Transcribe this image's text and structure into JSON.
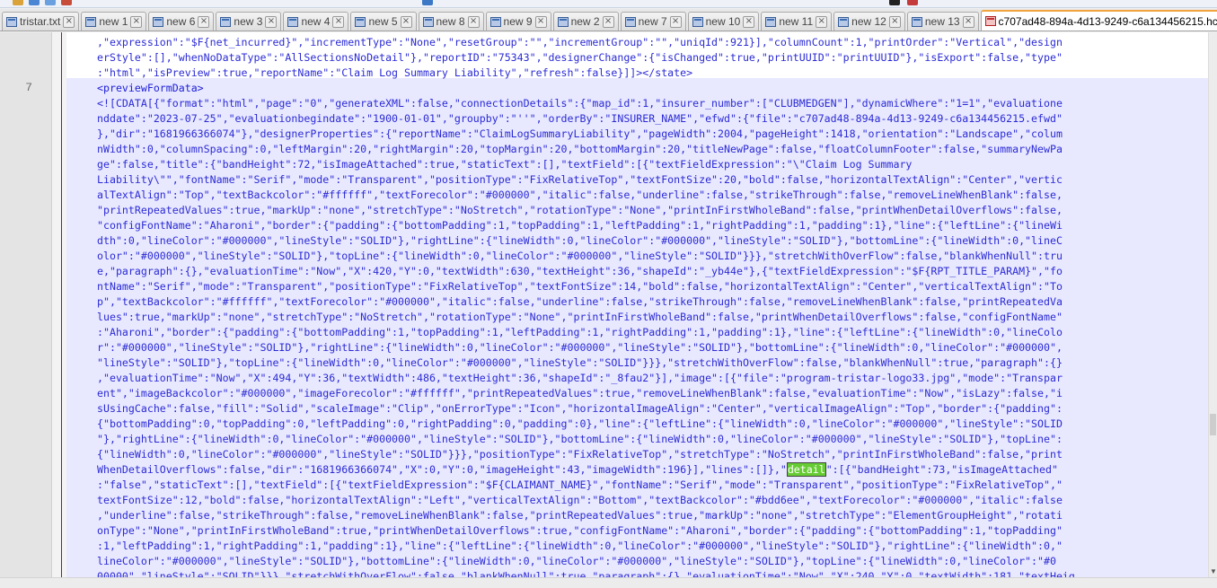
{
  "tabs": [
    {
      "label": "tristar.txt",
      "active": false,
      "icon": "file-icon"
    },
    {
      "label": "new 1",
      "active": false,
      "icon": "file-icon"
    },
    {
      "label": "new 6",
      "active": false,
      "icon": "file-icon"
    },
    {
      "label": "new 3",
      "active": false,
      "icon": "file-icon"
    },
    {
      "label": "new 4",
      "active": false,
      "icon": "file-icon"
    },
    {
      "label": "new 5",
      "active": false,
      "icon": "file-icon"
    },
    {
      "label": "new 8",
      "active": false,
      "icon": "file-icon"
    },
    {
      "label": "new 9",
      "active": false,
      "icon": "file-icon"
    },
    {
      "label": "new 2",
      "active": false,
      "icon": "file-icon"
    },
    {
      "label": "new 7",
      "active": false,
      "icon": "file-icon"
    },
    {
      "label": "new 10",
      "active": false,
      "icon": "file-icon"
    },
    {
      "label": "new 11",
      "active": false,
      "icon": "file-icon"
    },
    {
      "label": "new 12",
      "active": false,
      "icon": "file-icon"
    },
    {
      "label": "new 13",
      "active": false,
      "icon": "file-icon"
    },
    {
      "label": "c707ad48-894a-4d13-9249-c6a134456215.hcr",
      "active": true,
      "icon": "modified-file-icon"
    }
  ],
  "editor": {
    "line_number": "7",
    "prev_lines": [
      ",\"expression\":\"$F{net_incurred}\",\"incrementType\":\"None\",\"resetGroup\":\"\",\"incrementGroup\":\"\",\"uniqId\":921}],\"columnCount\":1,\"printOrder\":\"Vertical\",\"design",
      "erStyle\":[],\"whenNoDataType\":\"AllSectionsNoDetail\"},\"reportID\":\"75343\",\"designerChange\":{\"isChanged\":true,\"printUUID\":\"printUUID\"},\"isExport\":false,\"type\"",
      ":\"html\",\"isPreview\":true,\"reportName\":\"Claim Log Summary Liability\",\"refresh\":false}]]></state>"
    ],
    "tag_line": "<previewFormData>",
    "lines": [
      "<![CDATA[{\"format\":\"html\",\"page\":\"0\",\"generateXML\":false,\"connectionDetails\":{\"map_id\":1,\"insurer_number\":[\"CLUBMEDGEN\"],\"dynamicWhere\":\"1=1\",\"evaluatione",
      "nddate\":\"2023-07-25\",\"evaluationbegindate\":\"1900-01-01\",\"groupby\":\"''\",\"orderBy\":\"INSURER_NAME\",\"efwd\":{\"file\":\"c707ad48-894a-4d13-9249-c6a134456215.efwd\"",
      "},\"dir\":\"1681966366074\"},\"designerProperties\":{\"reportName\":\"ClaimLogSummaryLiability\",\"pageWidth\":2004,\"pageHeight\":1418,\"orientation\":\"Landscape\",\"colum",
      "nWidth\":0,\"columnSpacing\":0,\"leftMargin\":20,\"rightMargin\":20,\"topMargin\":20,\"bottomMargin\":20,\"titleNewPage\":false,\"floatColumnFooter\":false,\"summaryNewPa",
      "ge\":false,\"title\":{\"bandHeight\":72,\"isImageAttached\":true,\"staticText\":[],\"textField\":[{\"textFieldExpression\":\"\\\"Claim Log Summary",
      "Liability\\\"\",\"fontName\":\"Serif\",\"mode\":\"Transparent\",\"positionType\":\"FixRelativeTop\",\"textFontSize\":20,\"bold\":false,\"horizontalTextAlign\":\"Center\",\"vertic",
      "alTextAlign\":\"Top\",\"textBackcolor\":\"#ffffff\",\"textForecolor\":\"#000000\",\"italic\":false,\"underline\":false,\"strikeThrough\":false,\"removeLineWhenBlank\":false,",
      "\"printRepeatedValues\":true,\"markUp\":\"none\",\"stretchType\":\"NoStretch\",\"rotationType\":\"None\",\"printInFirstWholeBand\":false,\"printWhenDetailOverflows\":false,",
      "\"configFontName\":\"Aharoni\",\"border\":{\"padding\":{\"bottomPadding\":1,\"topPadding\":1,\"leftPadding\":1,\"rightPadding\":1,\"padding\":1},\"line\":{\"leftLine\":{\"lineWi",
      "dth\":0,\"lineColor\":\"#000000\",\"lineStyle\":\"SOLID\"},\"rightLine\":{\"lineWidth\":0,\"lineColor\":\"#000000\",\"lineStyle\":\"SOLID\"},\"bottomLine\":{\"lineWidth\":0,\"lineC",
      "olor\":\"#000000\",\"lineStyle\":\"SOLID\"},\"topLine\":{\"lineWidth\":0,\"lineColor\":\"#000000\",\"lineStyle\":\"SOLID\"}}},\"stretchWithOverFlow\":false,\"blankWhenNull\":tru",
      "e,\"paragraph\":{},\"evaluationTime\":\"Now\",\"X\":420,\"Y\":0,\"textWidth\":630,\"textHeight\":36,\"shapeId\":\"_yb44e\"},{\"textFieldExpression\":\"$F{RPT_TITLE_PARAM}\",\"fo",
      "ntName\":\"Serif\",\"mode\":\"Transparent\",\"positionType\":\"FixRelativeTop\",\"textFontSize\":14,\"bold\":false,\"horizontalTextAlign\":\"Center\",\"verticalTextAlign\":\"To",
      "p\",\"textBackcolor\":\"#ffffff\",\"textForecolor\":\"#000000\",\"italic\":false,\"underline\":false,\"strikeThrough\":false,\"removeLineWhenBlank\":false,\"printRepeatedVa",
      "lues\":true,\"markUp\":\"none\",\"stretchType\":\"NoStretch\",\"rotationType\":\"None\",\"printInFirstWholeBand\":false,\"printWhenDetailOverflows\":false,\"configFontName\"",
      ":\"Aharoni\",\"border\":{\"padding\":{\"bottomPadding\":1,\"topPadding\":1,\"leftPadding\":1,\"rightPadding\":1,\"padding\":1},\"line\":{\"leftLine\":{\"lineWidth\":0,\"lineColo",
      "r\":\"#000000\",\"lineStyle\":\"SOLID\"},\"rightLine\":{\"lineWidth\":0,\"lineColor\":\"#000000\",\"lineStyle\":\"SOLID\"},\"bottomLine\":{\"lineWidth\":0,\"lineColor\":\"#000000\",",
      "\"lineStyle\":\"SOLID\"},\"topLine\":{\"lineWidth\":0,\"lineColor\":\"#000000\",\"lineStyle\":\"SOLID\"}}},\"stretchWithOverFlow\":false,\"blankWhenNull\":true,\"paragraph\":{}",
      ",\"evaluationTime\":\"Now\",\"X\":494,\"Y\":36,\"textWidth\":486,\"textHeight\":36,\"shapeId\":\"_8fau2\"}],\"image\":[{\"file\":\"program-tristar-logo33.jpg\",\"mode\":\"Transpar",
      "ent\",\"imageBackcolor\":\"#000000\",\"imageForecolor\":\"#ffffff\",\"printRepeatedValues\":true,\"removeLineWhenBlank\":false,\"evaluationTime\":\"Now\",\"isLazy\":false,\"i",
      "sUsingCache\":false,\"fill\":\"Solid\",\"scaleImage\":\"Clip\",\"onErrorType\":\"Icon\",\"horizontalImageAlign\":\"Center\",\"verticalImageAlign\":\"Top\",\"border\":{\"padding\":",
      "{\"bottomPadding\":0,\"topPadding\":0,\"leftPadding\":0,\"rightPadding\":0,\"padding\":0},\"line\":{\"leftLine\":{\"lineWidth\":0,\"lineColor\":\"#000000\",\"lineStyle\":\"SOLID",
      "\"},\"rightLine\":{\"lineWidth\":0,\"lineColor\":\"#000000\",\"lineStyle\":\"SOLID\"},\"bottomLine\":{\"lineWidth\":0,\"lineColor\":\"#000000\",\"lineStyle\":\"SOLID\"},\"topLine\":",
      "{\"lineWidth\":0,\"lineColor\":\"#000000\",\"lineStyle\":\"SOLID\"}}},\"positionType\":\"FixRelativeTop\",\"stretchType\":\"NoStretch\",\"printInFirstWholeBand\":false,\"print",
      "WhenDetailOverflows\":false,\"dir\":\"1681966366074\",\"X\":0,\"Y\":0,\"imageHeight\":43,\"imageWidth\":196}],\"lines\":[]},\"",
      ":\"false\",\"staticText\":[],\"textField\":[{\"textFieldExpression\":\"$F{CLAIMANT_NAME}\",\"fontName\":\"Serif\",\"mode\":\"Transparent\",\"positionType\":\"FixRelativeTop\",\"",
      "textFontSize\":12,\"bold\":false,\"horizontalTextAlign\":\"Left\",\"verticalTextAlign\":\"Bottom\",\"textBackcolor\":\"#bdd6ee\",\"textForecolor\":\"#000000\",\"italic\":false",
      ",\"underline\":false,\"strikeThrough\":false,\"removeLineWhenBlank\":false,\"printRepeatedValues\":true,\"markUp\":\"none\",\"stretchType\":\"ElementGroupHeight\",\"rotati",
      "onType\":\"None\",\"printInFirstWholeBand\":true,\"printWhenDetailOverflows\":true,\"configFontName\":\"Aharoni\",\"border\":{\"padding\":{\"bottomPadding\":1,\"topPadding\"",
      ":1,\"leftPadding\":1,\"rightPadding\":1,\"padding\":1},\"line\":{\"leftLine\":{\"lineWidth\":0,\"lineColor\":\"#000000\",\"lineStyle\":\"SOLID\"},\"rightLine\":{\"lineWidth\":0,\"",
      "lineColor\":\"#000000\",\"lineStyle\":\"SOLID\"},\"bottomLine\":{\"lineWidth\":0,\"lineColor\":\"#000000\",\"lineStyle\":\"SOLID\"},\"topLine\":{\"lineWidth\":0,\"lineColor\":\"#0",
      "00000\",\"lineStyle\":\"SOLID\"}}},\"stretchWithOverFlow\":false,\"blankWhenNull\":true,\"paragraph\":{},\"evaluationTime\":\"Now\",\"X\":240,\"Y\":0,\"textWidth\":181,\"textHeig"
    ],
    "search_highlight": "detail",
    "search_highlight_suffix": "\":[{\"bandHeight\":73,\"isImageAttached\""
  },
  "colors": {
    "highlight": "#66cc33",
    "selection_band": "#e8e8ff",
    "text": "#2b2bd5",
    "active_tab_accent": "#f1a33e"
  }
}
